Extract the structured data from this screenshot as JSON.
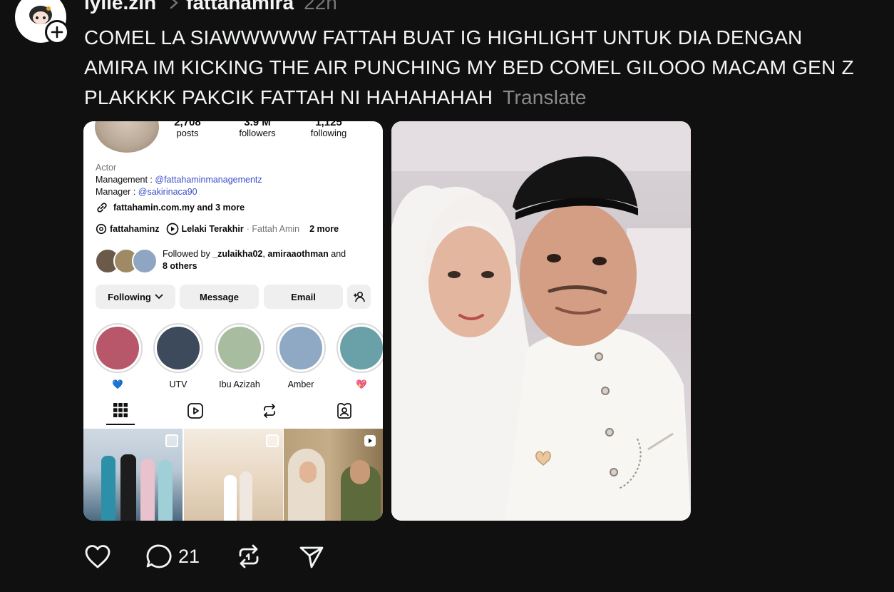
{
  "header": {
    "author": "lylie.zin",
    "reply_to": "fattahamira",
    "time": "22h"
  },
  "post": {
    "text": "COMEL LA SIAWWWWW FATTAH BUAT IG HIGHLIGHT UNTUK DIA DENGAN AMIRA IM KICKING THE AIR PUNCHING MY BED COMEL GILOOO MACAM GEN Z PLAKKKK PAKCIK FATTAH NI HAHAHAHAH",
    "translate_label": "Translate"
  },
  "ig_profile": {
    "stats": [
      {
        "num": "2,708",
        "label": "posts"
      },
      {
        "num": "3.9 M",
        "label": "followers"
      },
      {
        "num": "1,125",
        "label": "following"
      }
    ],
    "category": "Actor",
    "management_label": "Management : ",
    "management_handle": "@fattahaminmanagementz",
    "manager_label": "Manager : ",
    "manager_handle": "@sakirinaca90",
    "link_text": "fattahamin.com.my and 3 more",
    "threads_handle": "fattahaminz",
    "song_title": "Lelaki Terakhir",
    "song_artist": "· Fattah Amin",
    "more_label": "2 more",
    "followed_by_prefix": "Followed by ",
    "followed_by_names": "_zulaikha02",
    "followed_by_sep": ", ",
    "followed_by_names2": "amiraaothman",
    "followed_by_and": " and",
    "followed_by_others": "8 others",
    "buttons": {
      "following": "Following",
      "message": "Message",
      "email": "Email"
    },
    "highlights": [
      {
        "label": "💙",
        "color": "#b8566a"
      },
      {
        "label": "UTV",
        "color": "#3d4a5c"
      },
      {
        "label": "Ibu Azizah",
        "color": "#a8bca0"
      },
      {
        "label": "Amber",
        "color": "#8fa9c4"
      },
      {
        "label": "💖",
        "color": "#6aa0a8"
      }
    ]
  },
  "actions": {
    "reply_count": "21"
  },
  "colors": {
    "background": "#101010",
    "text": "#f3f5f7",
    "muted": "#8a8a8a",
    "ig_link_blue": "#3b4fc9"
  }
}
